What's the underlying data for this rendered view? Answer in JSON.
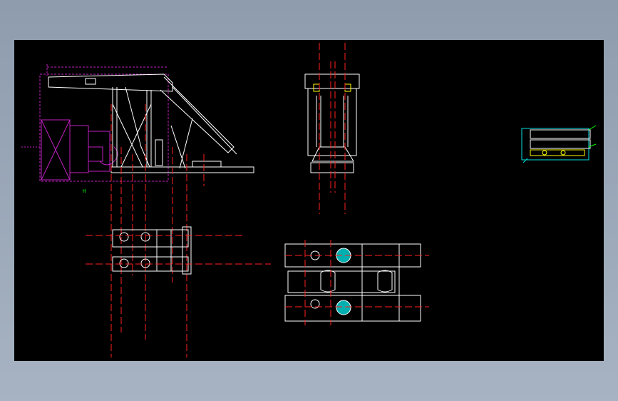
{
  "drawing": {
    "colors": {
      "background": "#000000",
      "frame": "#8e9cae",
      "outline": "#ffffff",
      "centerline": "#ff2020",
      "dimension": "#c020c0",
      "detail_yellow": "#ffff00",
      "detail_cyan": "#00e0e0",
      "detail_green": "#00ff00",
      "hatch": "#00b0b0"
    },
    "labels": {
      "marker_text": "H"
    }
  }
}
